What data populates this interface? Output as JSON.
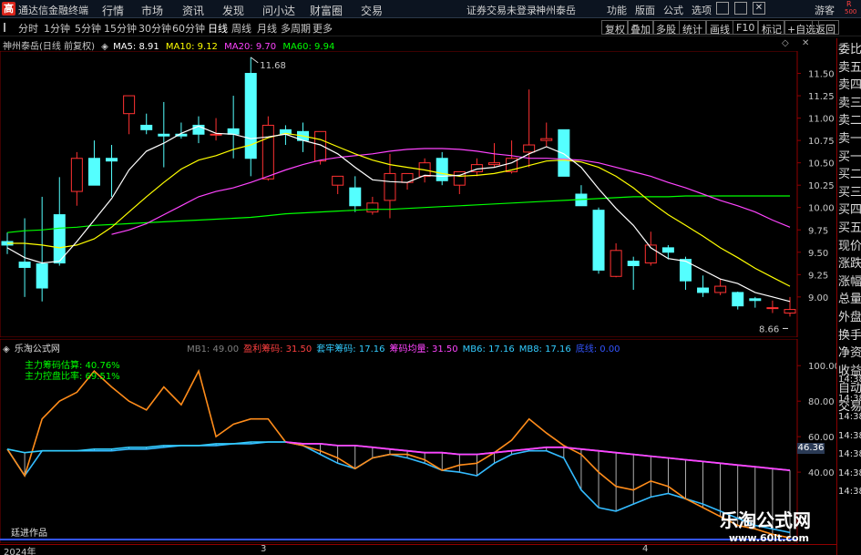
{
  "titlebar": {
    "app_icon": "高",
    "app_title": "通达信金融终端",
    "menus": [
      "行情",
      "市场",
      "资讯",
      "发现",
      "问小达",
      "财富圈",
      "交易"
    ],
    "notice": "证券交易未登录",
    "stock": "神州泰岳",
    "right_buttons": [
      "功能",
      "版面",
      "公式",
      "选项"
    ],
    "guest": "游客",
    "r_badge": "R",
    "r_num": "500"
  },
  "toolbar": {
    "periods": [
      "分时",
      "1分钟",
      "5分钟",
      "15分钟",
      "30分钟",
      "60分钟",
      "日线",
      "周线",
      "月线",
      "多周期",
      "更多"
    ],
    "active": "日线",
    "right": [
      "复权",
      "叠加",
      "多股",
      "统计",
      "画线",
      "F10",
      "标记",
      "+自选",
      "返回"
    ]
  },
  "info": {
    "name": "神州泰岳(日线 前复权)",
    "ma5": "MA5: 8.91",
    "ma10": "MA10: 9.12",
    "ma20": "MA20: 9.70",
    "ma60": "MA60: 9.94",
    "high_label": "11.68",
    "low_label": "8.66"
  },
  "side_labels": [
    "委比",
    "卖五",
    "卖四",
    "卖三",
    "卖二",
    "卖一",
    "买一",
    "买二",
    "买三",
    "买四",
    "买五",
    "现价",
    "涨跌",
    "涨幅",
    "总量",
    "外盘",
    "换手",
    "净资",
    "收益",
    "自动",
    "交易"
  ],
  "indicator": {
    "name": "乐淘公式网",
    "items": [
      {
        "label": "MB1: 49.00",
        "color": "#808080"
      },
      {
        "label": "盈利筹码: 31.50",
        "color": "#ff4040"
      },
      {
        "label": "套牢筹码: 17.16",
        "color": "#33ccff"
      },
      {
        "label": "筹码均量: 31.50",
        "color": "#ff44ff"
      },
      {
        "label": "MB6: 17.16",
        "color": "#33ccff"
      },
      {
        "label": "MB8: 17.16",
        "color": "#33ccff"
      },
      {
        "label": "底线: 0.00",
        "color": "#3355ff"
      }
    ],
    "line1": "主力筹码估算: 40.76%",
    "line2": "主力控盘比率: 69.51%",
    "current_value": "46.36",
    "right_labels": [
      "14:38",
      "14:38",
      "14:38",
      "14:38",
      "14:38",
      "14:38",
      "14:38"
    ],
    "author": "廷进作品"
  },
  "watermark": {
    "title": "乐淘公式网",
    "url": "www.60lt.com"
  },
  "dates": [
    "2024年",
    "3",
    "4"
  ],
  "colors": {
    "up": "#ff3232",
    "down": "#54ffff",
    "ma5": "#ffffff",
    "ma10": "#ffff00",
    "ma20": "#ff44ff",
    "ma60": "#00ff00"
  },
  "chart_data": [
    {
      "type": "candlestick",
      "title": "神州泰岳(日线 前复权)",
      "ylim": [
        8.55,
        11.75
      ],
      "yticks": [
        11.5,
        11.25,
        11.0,
        10.75,
        10.5,
        10.25,
        10.0,
        9.75,
        9.5,
        9.25,
        9.0
      ],
      "ohlc": [
        [
          9.62,
          9.72,
          9.48,
          9.58
        ],
        [
          9.39,
          9.88,
          9.0,
          9.33
        ],
        [
          9.37,
          10.12,
          8.95,
          9.1
        ],
        [
          9.92,
          10.34,
          9.35,
          9.38
        ],
        [
          10.18,
          10.62,
          10.02,
          10.55
        ],
        [
          10.55,
          10.75,
          10.35,
          10.25
        ],
        [
          10.55,
          10.7,
          10.12,
          10.52
        ],
        [
          11.05,
          11.25,
          10.82,
          11.25
        ],
        [
          10.92,
          11.05,
          10.82,
          10.87
        ],
        [
          10.82,
          11.18,
          10.45,
          10.8
        ],
        [
          10.82,
          10.95,
          10.77,
          10.8
        ],
        [
          10.92,
          11.02,
          10.72,
          10.82
        ],
        [
          10.82,
          11.0,
          10.75,
          10.82
        ],
        [
          10.88,
          11.25,
          10.55,
          10.82
        ],
        [
          11.5,
          11.68,
          10.35,
          10.55
        ],
        [
          10.32,
          11.02,
          10.3,
          10.92
        ],
        [
          10.87,
          10.92,
          10.7,
          10.82
        ],
        [
          10.85,
          10.95,
          10.62,
          10.75
        ],
        [
          10.52,
          10.82,
          10.48,
          10.85
        ],
        [
          10.25,
          10.35,
          10.15,
          10.35
        ],
        [
          10.22,
          10.35,
          9.95,
          10.02
        ],
        [
          9.95,
          10.12,
          9.92,
          10.05
        ],
        [
          10.08,
          10.6,
          9.88,
          10.38
        ],
        [
          10.28,
          10.38,
          10.2,
          10.38
        ],
        [
          10.35,
          10.55,
          10.28,
          10.5
        ],
        [
          10.55,
          10.62,
          10.25,
          10.3
        ],
        [
          10.25,
          10.4,
          10.15,
          10.4
        ],
        [
          10.4,
          10.55,
          10.35,
          10.48
        ],
        [
          10.48,
          10.72,
          10.45,
          10.5
        ],
        [
          10.4,
          10.75,
          10.38,
          10.55
        ],
        [
          10.62,
          11.32,
          10.45,
          10.7
        ],
        [
          10.75,
          10.95,
          10.68,
          10.77
        ],
        [
          10.87,
          10.75,
          10.36,
          10.35
        ],
        [
          10.15,
          10.25,
          10.02,
          10.02
        ],
        [
          9.97,
          10.0,
          9.26,
          9.3
        ],
        [
          9.23,
          9.6,
          9.22,
          9.52
        ],
        [
          9.4,
          9.45,
          9.08,
          9.35
        ],
        [
          9.38,
          9.73,
          9.35,
          9.58
        ],
        [
          9.55,
          9.58,
          9.42,
          9.5
        ],
        [
          9.42,
          9.45,
          9.08,
          9.18
        ],
        [
          9.1,
          9.24,
          9.0,
          9.05
        ],
        [
          9.05,
          9.2,
          9.02,
          9.12
        ],
        [
          9.05,
          9.06,
          8.86,
          8.9
        ],
        [
          8.98,
          9.0,
          8.88,
          8.96
        ],
        [
          8.88,
          8.96,
          8.82,
          8.88
        ],
        [
          8.82,
          9.0,
          8.78,
          8.86
        ]
      ],
      "ma5": [
        9.55,
        9.44,
        9.38,
        9.4,
        9.62,
        9.86,
        10.1,
        10.42,
        10.63,
        10.72,
        10.83,
        10.91,
        10.83,
        10.82,
        10.77,
        10.79,
        10.82,
        10.75,
        10.7,
        10.6,
        10.45,
        10.31,
        10.29,
        10.28,
        10.36,
        10.35,
        10.36,
        10.43,
        10.45,
        10.5,
        10.6,
        10.68,
        10.6,
        10.45,
        10.21,
        9.99,
        9.8,
        9.55,
        9.43,
        9.4,
        9.3,
        9.2,
        9.15,
        9.05,
        9.0,
        8.95
      ],
      "ma10": [
        9.6,
        9.6,
        9.58,
        9.55,
        9.58,
        9.65,
        9.78,
        9.95,
        10.12,
        10.28,
        10.43,
        10.53,
        10.58,
        10.65,
        10.7,
        10.78,
        10.83,
        10.8,
        10.76,
        10.68,
        10.6,
        10.53,
        10.48,
        10.45,
        10.42,
        10.38,
        10.35,
        10.36,
        10.38,
        10.42,
        10.47,
        10.52,
        10.53,
        10.51,
        10.45,
        10.35,
        10.22,
        10.06,
        9.92,
        9.8,
        9.68,
        9.55,
        9.44,
        9.32,
        9.22,
        9.12
      ],
      "ma20": [
        null,
        null,
        null,
        null,
        null,
        null,
        9.7,
        9.75,
        9.82,
        9.92,
        10.02,
        10.12,
        10.18,
        10.22,
        10.28,
        10.35,
        10.42,
        10.48,
        10.53,
        10.56,
        10.58,
        10.6,
        10.63,
        10.65,
        10.66,
        10.66,
        10.65,
        10.63,
        10.6,
        10.58,
        10.55,
        10.55,
        10.54,
        10.53,
        10.5,
        10.45,
        10.4,
        10.35,
        10.28,
        10.22,
        10.15,
        10.08,
        10.02,
        9.95,
        9.86,
        9.78
      ],
      "ma60": [
        9.72,
        9.74,
        9.75,
        9.77,
        9.78,
        9.8,
        9.81,
        9.82,
        9.83,
        9.84,
        9.85,
        9.86,
        9.87,
        9.88,
        9.89,
        9.91,
        9.93,
        9.94,
        9.95,
        9.96,
        9.97,
        9.98,
        9.98,
        9.99,
        10.0,
        10.01,
        10.02,
        10.03,
        10.04,
        10.05,
        10.06,
        10.07,
        10.08,
        10.09,
        10.1,
        10.11,
        10.12,
        10.12,
        10.12,
        10.13,
        10.13,
        10.13,
        10.13,
        10.13,
        10.13,
        10.13
      ]
    },
    {
      "type": "line",
      "title": "乐淘公式网",
      "ylim": [
        0,
        115
      ],
      "yticks": [
        100.0,
        80.0,
        60.0,
        40.0
      ],
      "series": [
        {
          "name": "盈利筹码",
          "values": [
            53,
            38,
            70,
            80,
            85,
            97,
            88,
            80,
            75,
            88,
            78,
            97,
            60,
            67,
            70,
            70,
            57,
            55,
            52,
            48,
            42,
            48,
            50,
            50,
            47,
            41,
            44,
            45,
            51,
            58,
            70,
            62,
            55,
            50,
            40,
            32,
            30,
            35,
            32,
            25,
            20,
            15,
            10,
            8,
            5,
            3
          ]
        },
        {
          "name": "筹码均量",
          "values": [
            53,
            51,
            52,
            52,
            52,
            53,
            53,
            54,
            54,
            55,
            55,
            55,
            56,
            56,
            57,
            57,
            57,
            56,
            56,
            55,
            55,
            54,
            53,
            52,
            51,
            51,
            50,
            50,
            51,
            52,
            53,
            54,
            54,
            53,
            52,
            51,
            50,
            49,
            48,
            47,
            46,
            45,
            44,
            43,
            42,
            41
          ]
        },
        {
          "name": "套牢筹码",
          "values": [
            53,
            38,
            52,
            52,
            52,
            52,
            52,
            53,
            53,
            54,
            55,
            55,
            55,
            56,
            56,
            57,
            57,
            55,
            50,
            45,
            42,
            48,
            50,
            48,
            45,
            41,
            40,
            38,
            45,
            50,
            52,
            52,
            48,
            30,
            20,
            18,
            22,
            26,
            28,
            25,
            22,
            18,
            14,
            10,
            8,
            6
          ]
        }
      ]
    }
  ]
}
